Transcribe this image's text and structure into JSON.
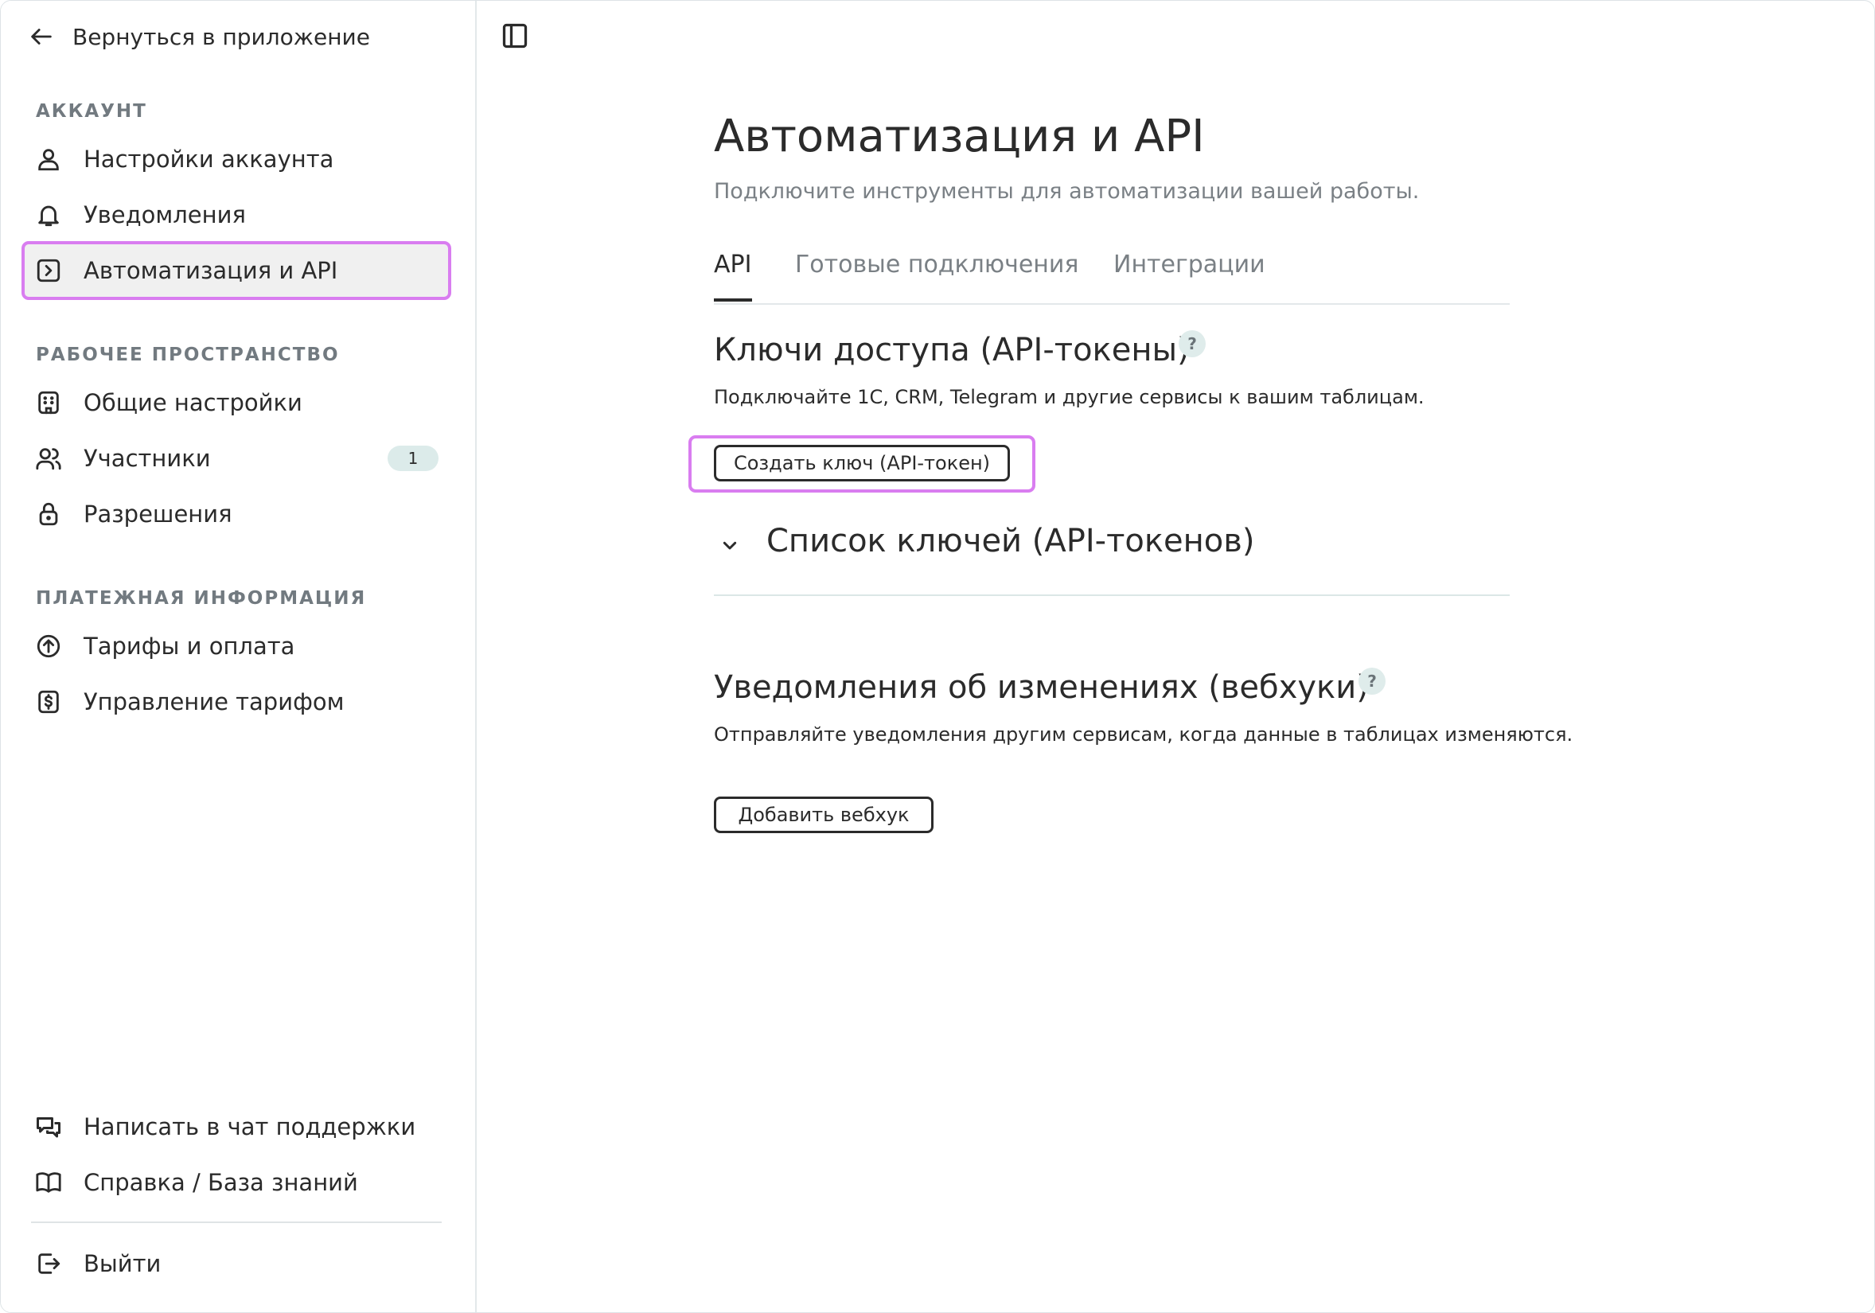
{
  "sidebar": {
    "back_label": "Вернуться в приложение",
    "account_label": "АККАУНТ",
    "account_items": [
      {
        "label": "Настройки аккаунта",
        "icon": "user-icon"
      },
      {
        "label": "Уведомления",
        "icon": "bell-icon"
      },
      {
        "label": "Автоматизация и API",
        "icon": "automation-icon",
        "active": true
      }
    ],
    "workspace_label": "РАБОЧЕЕ ПРОСТРАНСТВО",
    "workspace_items": [
      {
        "label": "Общие настройки",
        "icon": "building-icon"
      },
      {
        "label": "Участники",
        "icon": "users-icon",
        "badge": "1"
      },
      {
        "label": "Разрешения",
        "icon": "lock-icon"
      }
    ],
    "billing_label": "ПЛАТЕЖНАЯ ИНФОРМАЦИЯ",
    "billing_items": [
      {
        "label": "Тарифы и оплата",
        "icon": "arrow-up-circle-icon"
      },
      {
        "label": "Управление тарифом",
        "icon": "dollar-icon"
      }
    ],
    "footer_items": [
      {
        "label": "Написать в чат поддержки",
        "icon": "chat-icon"
      },
      {
        "label": "Справка / База знаний",
        "icon": "book-icon"
      },
      {
        "label": "Выйти",
        "icon": "logout-icon"
      }
    ]
  },
  "main": {
    "title": "Автоматизация и API",
    "subtitle": "Подключите инструменты для автоматизации вашей работы.",
    "tabs": [
      {
        "label": "API",
        "active": true
      },
      {
        "label": "Готовые подключения"
      },
      {
        "label": "Интеграции"
      }
    ],
    "tokens": {
      "heading": "Ключи доступа (API-токены)",
      "help": "?",
      "description": "Подключайте 1С, CRM, Telegram и другие сервисы к вашим таблицам.",
      "create_button": "Создать ключ (API-токен)",
      "list_heading": "Список ключей (API-токенов)"
    },
    "webhooks": {
      "heading": "Уведомления об изменениях (вебхуки)",
      "help": "?",
      "description": "Отправляйте уведомления другим сервисам, когда данные в таблицах изменяются.",
      "add_button": "Добавить вебхук"
    }
  },
  "colors": {
    "highlight": "#d97df0",
    "text": "#2b2b2b",
    "muted": "#7a8085",
    "badge_bg": "#dcebea"
  }
}
